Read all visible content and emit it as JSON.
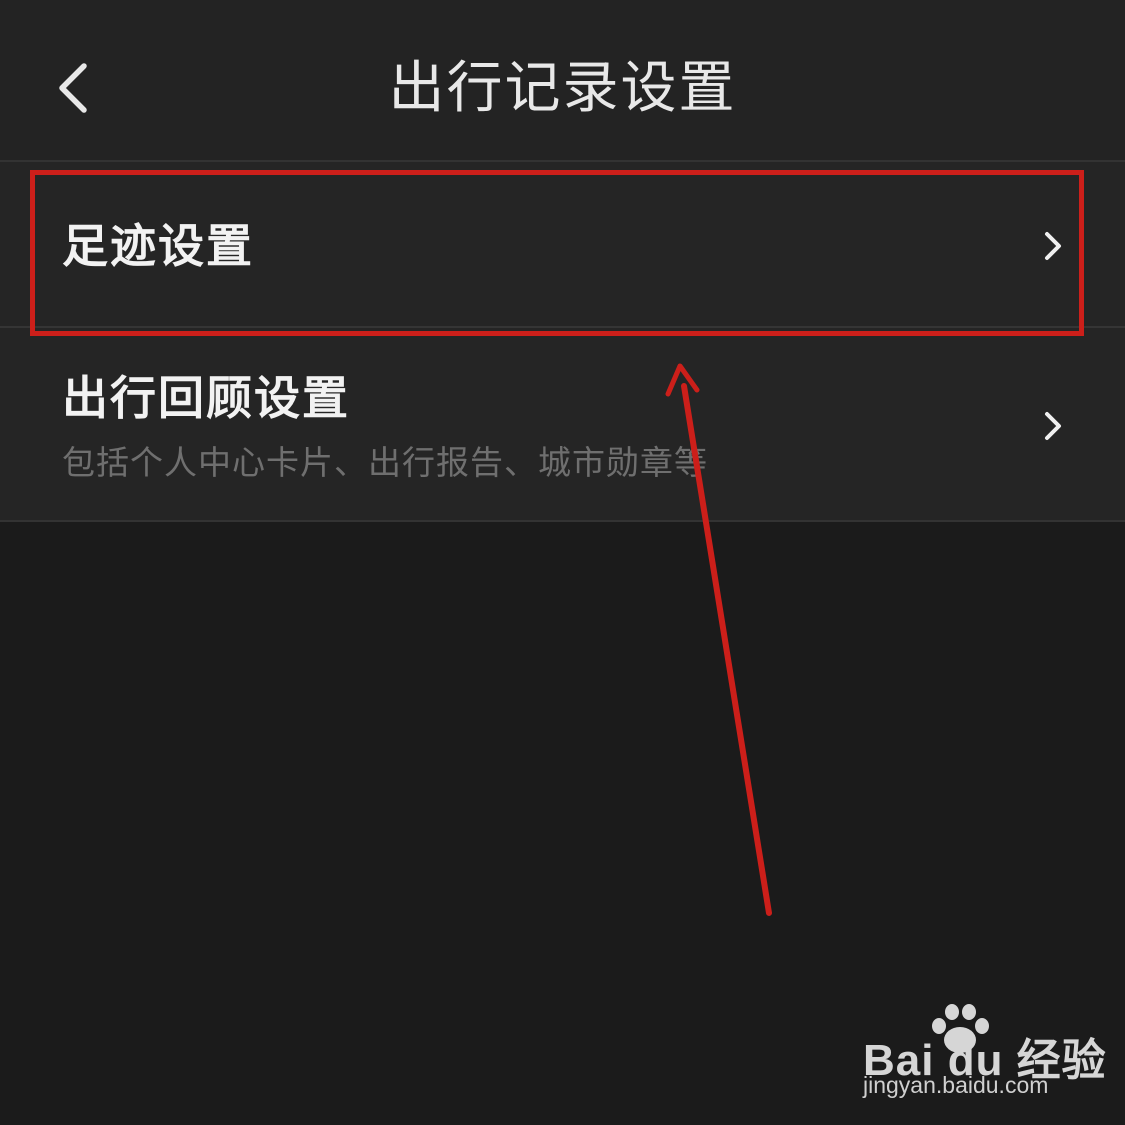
{
  "header": {
    "title": "出行记录设置",
    "back_icon": "chevron-left-icon"
  },
  "settings": [
    {
      "title": "足迹设置",
      "subtitle": "",
      "icon": "chevron-right-icon",
      "highlighted": true
    },
    {
      "title": "出行回顾设置",
      "subtitle": "包括个人中心卡片、出行报告、城市勋章等",
      "icon": "chevron-right-icon",
      "highlighted": false
    }
  ],
  "annotation": {
    "color": "#cc1f1a"
  },
  "watermark": {
    "brand": "Bai du 经验",
    "url": "jingyan.baidu.com",
    "logo_icon": "paw-icon"
  }
}
